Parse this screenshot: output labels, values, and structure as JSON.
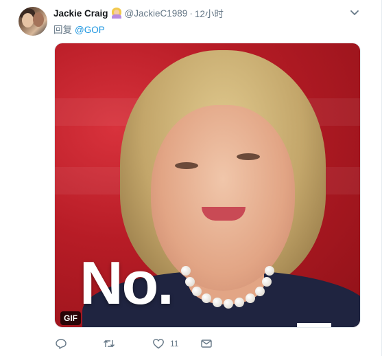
{
  "tweet": {
    "display_name": "Jackie Craig",
    "emoji": "person-gesturing-no-emoji",
    "handle": "@JackieC1989",
    "dot": "·",
    "time": "12小时",
    "reply_label": "回复",
    "reply_mention": "@GOP",
    "media": {
      "overlay_text": "No.",
      "gif_badge": "GIF"
    },
    "actions": {
      "reply": {
        "icon": "reply-icon"
      },
      "retweet": {
        "icon": "retweet-icon"
      },
      "like": {
        "icon": "heart-icon",
        "count": "11"
      },
      "message": {
        "icon": "envelope-icon"
      }
    },
    "menu": {
      "icon": "chevron-down-icon"
    }
  },
  "colors": {
    "link": "#1b95e0",
    "secondary_text": "#657786",
    "primary_text": "#14171a",
    "media_background": "#b71c26"
  }
}
